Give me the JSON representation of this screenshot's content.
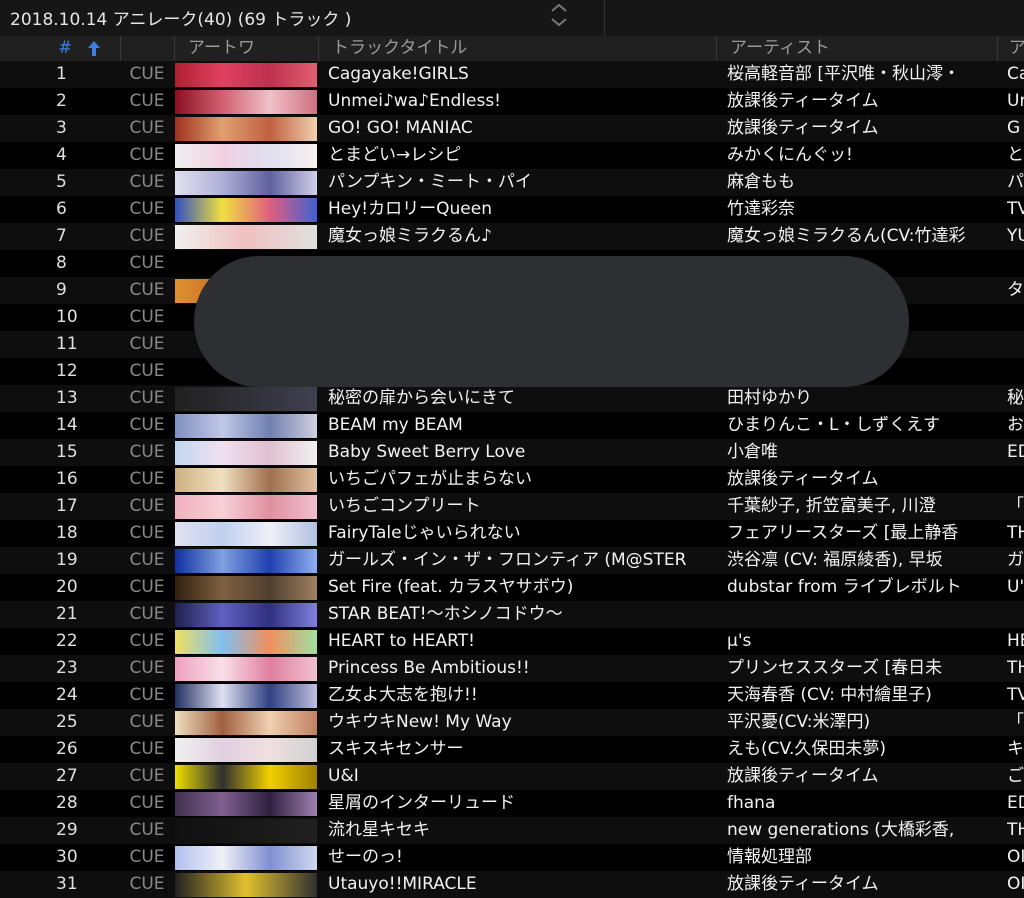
{
  "window": {
    "title": "2018.10.14 アニレーク(40) (69 トラック )"
  },
  "columns": {
    "num": "#",
    "artwork": "アートワ",
    "title": "トラックタイトル",
    "artist": "アーティスト",
    "extra": "ア"
  },
  "tracks": [
    {
      "num": "1",
      "cue": "CUE",
      "title": "Cagayake!GIRLS",
      "artist": "桜高軽音部 [平沢唯・秋山澪・",
      "extra": "Ca",
      "art": "art1"
    },
    {
      "num": "2",
      "cue": "CUE",
      "title": "Unmei♪wa♪Endless!",
      "artist": "放課後ティータイム",
      "extra": "Ur",
      "art": "art2"
    },
    {
      "num": "3",
      "cue": "CUE",
      "title": "GO! GO! MANIAC",
      "artist": "放課後ティータイム",
      "extra": "G",
      "art": "art3"
    },
    {
      "num": "4",
      "cue": "CUE",
      "title": "とまどい→レシピ",
      "artist": "みかくにんぐッ!",
      "extra": "と",
      "art": "art4"
    },
    {
      "num": "5",
      "cue": "CUE",
      "title": "パンプキン・ミート・パイ",
      "artist": "麻倉もも",
      "extra": "パ",
      "art": "art5"
    },
    {
      "num": "6",
      "cue": "CUE",
      "title": "Hey!カロリーQueen",
      "artist": "竹達彩奈",
      "extra": "TV",
      "art": "art6"
    },
    {
      "num": "7",
      "cue": "CUE",
      "title": "魔女っ娘ミラクるん♪",
      "artist": "魔女っ娘ミラクるん(CV:竹達彩",
      "extra": "YU",
      "art": "art7"
    },
    {
      "num": "8",
      "cue": "CUE",
      "title": "",
      "artist": "",
      "extra": "",
      "art": ""
    },
    {
      "num": "9",
      "cue": "CUE",
      "title": "",
      "artist": "",
      "extra": "タ",
      "art": "art9"
    },
    {
      "num": "10",
      "cue": "CUE",
      "title": "",
      "artist": "",
      "extra": "",
      "art": ""
    },
    {
      "num": "11",
      "cue": "CUE",
      "title": "",
      "artist": "",
      "extra": "",
      "art": ""
    },
    {
      "num": "12",
      "cue": "CUE",
      "title": "",
      "artist": "",
      "extra": "",
      "art": ""
    },
    {
      "num": "13",
      "cue": "CUE",
      "title": "秘密の扉から会いにきて",
      "artist": "田村ゆかり",
      "extra": "秘",
      "art": "art13"
    },
    {
      "num": "14",
      "cue": "CUE",
      "title": "BEAM my BEAM",
      "artist": "ひまりんこ・L・しずくえす",
      "extra": "お",
      "art": "art14"
    },
    {
      "num": "15",
      "cue": "CUE",
      "title": "Baby Sweet Berry Love",
      "artist": "小倉唯",
      "extra": "ED",
      "art": "art15"
    },
    {
      "num": "16",
      "cue": "CUE",
      "title": "いちごパフェが止まらない",
      "artist": "放課後ティータイム",
      "extra": "",
      "art": "art16"
    },
    {
      "num": "17",
      "cue": "CUE",
      "title": "いちごコンプリート",
      "artist": "千葉紗子, 折笠富美子, 川澄",
      "extra": "「Ö",
      "art": "art17"
    },
    {
      "num": "18",
      "cue": "CUE",
      "title": "FairyTaleじゃいられない",
      "artist": "フェアリースターズ [最上静香",
      "extra": "TH",
      "art": "art18"
    },
    {
      "num": "19",
      "cue": "CUE",
      "title": "ガールズ・イン・ザ・フロンティア (M@STER",
      "artist": "渋谷凛 (CV: 福原綾香), 早坂",
      "extra": "ガ",
      "art": "art19"
    },
    {
      "num": "20",
      "cue": "CUE",
      "title": "Set Fire (feat. カラスヤサボウ)",
      "artist": "dubstar from ライブレボルト",
      "extra": "U'",
      "art": "art20"
    },
    {
      "num": "21",
      "cue": "CUE",
      "title": "STAR BEAT!〜ホシノコドウ〜",
      "artist": "",
      "extra": "",
      "art": "art21"
    },
    {
      "num": "22",
      "cue": "CUE",
      "title": "HEART to HEART!",
      "artist": "μ's",
      "extra": "HE",
      "art": "art22"
    },
    {
      "num": "23",
      "cue": "CUE",
      "title": "Princess Be Ambitious!!",
      "artist": "プリンセススターズ [春日未",
      "extra": "TH",
      "art": "art23"
    },
    {
      "num": "24",
      "cue": "CUE",
      "title": "乙女よ大志を抱け!!",
      "artist": "天海春香 (CV: 中村繪里子)",
      "extra": "TV",
      "art": "art24"
    },
    {
      "num": "25",
      "cue": "CUE",
      "title": "ウキウキNew! My Way",
      "artist": "平沢憂(CV:米澤円)",
      "extra": "「I",
      "art": "art25"
    },
    {
      "num": "26",
      "cue": "CUE",
      "title": "スキスキセンサー",
      "artist": "えも(CV.久保田未夢)",
      "extra": "キ",
      "art": "art26"
    },
    {
      "num": "27",
      "cue": "CUE",
      "title": "U&I",
      "artist": "放課後ティータイム",
      "extra": "ご",
      "art": "art27"
    },
    {
      "num": "28",
      "cue": "CUE",
      "title": "星屑のインターリュード",
      "artist": "fhana",
      "extra": "ED",
      "art": "art28"
    },
    {
      "num": "29",
      "cue": "CUE",
      "title": "流れ星キセキ",
      "artist": "new generations (大橋彩香,",
      "extra": "TH",
      "art": "art29"
    },
    {
      "num": "30",
      "cue": "CUE",
      "title": "せーのっ!",
      "artist": "情報処理部",
      "extra": "OI",
      "art": "art30"
    },
    {
      "num": "31",
      "cue": "CUE",
      "title": "Utauyo!!MIRACLE",
      "artist": "放課後ティータイム",
      "extra": "OI",
      "art": "art31"
    }
  ]
}
